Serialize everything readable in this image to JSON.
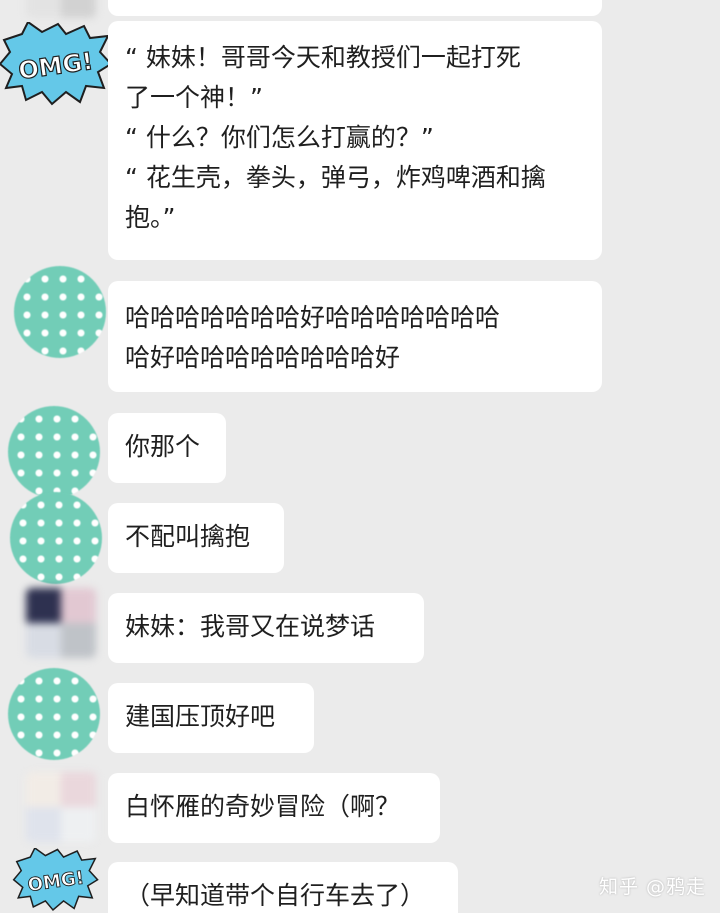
{
  "colors": {
    "background": "#ebebeb",
    "bubble": "#ffffff",
    "text": "#1f1f1f",
    "omg_badge": "#64c8e8",
    "dot_avatar": "#72cdb7"
  },
  "messages": [
    {
      "avatar": "omg-sticker",
      "lines": [
        "“ 妹妹！哥哥今天和教授们一起打死",
        "了一个神！”",
        "“ 什么？你们怎么打赢的？”",
        "“ 花生壳，拳头，弹弓，炸鸡啤酒和擒",
        "抱。”"
      ]
    },
    {
      "avatar": "polka-dot-avatar",
      "lines": [
        "哈哈哈哈哈哈哈好哈哈哈哈哈哈哈",
        "哈好哈哈哈哈哈哈哈哈好"
      ]
    },
    {
      "avatar": "polka-dot-avatar",
      "lines": [
        "你那个"
      ]
    },
    {
      "avatar": "polka-dot-avatar",
      "lines": [
        "不配叫擒抱"
      ]
    },
    {
      "avatar": "blurred-avatar",
      "lines": [
        "妹妹：我哥又在说梦话"
      ]
    },
    {
      "avatar": "polka-dot-avatar",
      "lines": [
        "建国压顶好吧"
      ]
    },
    {
      "avatar": "blurred-avatar",
      "lines": [
        "白怀雁的奇妙冒险（啊？"
      ]
    },
    {
      "avatar": "omg-sticker",
      "lines": [
        "（早知道带个自行车去了）"
      ]
    }
  ],
  "omg_label": "OMG!",
  "watermark": "知乎 @鸦走"
}
